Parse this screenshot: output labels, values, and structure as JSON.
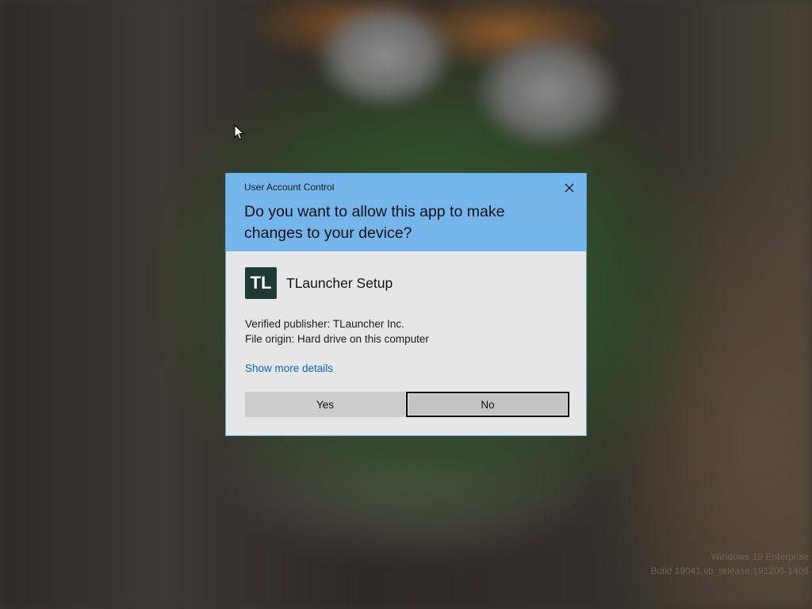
{
  "dialog": {
    "title": "User Account Control",
    "question": "Do you want to allow this app to make changes to your device?",
    "app": {
      "icon_text": "TL",
      "name": "TLauncher Setup"
    },
    "publisher_line": "Verified publisher: TLauncher Inc.",
    "origin_line": "File origin: Hard drive on this computer",
    "more_details": "Show more details",
    "yes_label": "Yes",
    "no_label": "No",
    "close_icon": "close-icon"
  },
  "watermark": {
    "line1": "Windows 10 Enterprise",
    "line2": "Build 19041.vb_release.191206-1406"
  },
  "colors": {
    "header_bg": "#74b5ec",
    "body_bg": "#e6e6e6",
    "link": "#0a66b8",
    "app_icon_bg": "#1d3a33"
  }
}
